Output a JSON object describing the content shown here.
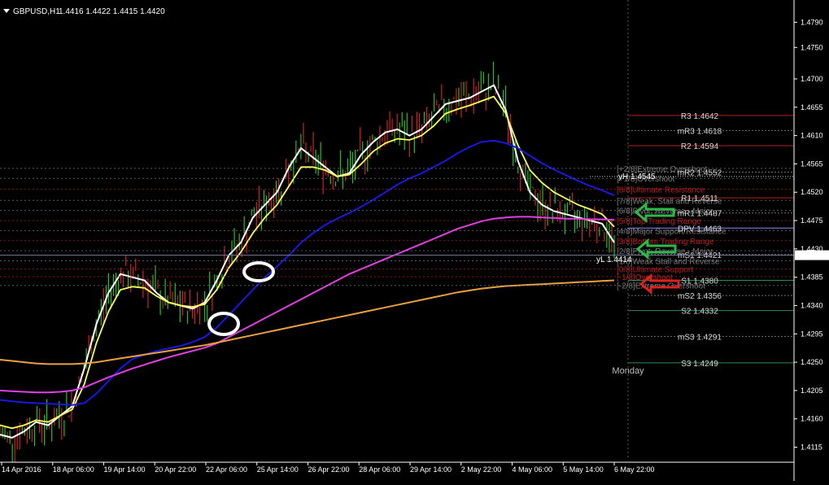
{
  "header": {
    "symbol": "GBPUSD,H1",
    "ohlc": "1.4416 1.4422 1.4415 1.4420",
    "arrow_icon": "triangle-down-icon"
  },
  "chart_data": {
    "type": "line",
    "title": "GBPUSD,H1",
    "ylim": [
      1.4095,
      1.4815
    ],
    "price_ticks": [
      "1.4790",
      "1.4750",
      "1.4700",
      "1.4655",
      "1.4610",
      "1.4565",
      "1.4520",
      "1.4475",
      "1.4430",
      "1.4385",
      "1.4340",
      "1.4295",
      "1.4250",
      "1.4205",
      "1.4160",
      "1.4115"
    ],
    "time_ticks": [
      "14 Apr 2016",
      "18 Apr 06:00",
      "19 Apr 14:00",
      "20 Apr 22:00",
      "22 Apr 06:00",
      "25 Apr 14:00",
      "26 Apr 22:00",
      "28 Apr 06:00",
      "29 Apr 14:00",
      "2 May 22:00",
      "4 May 06:00",
      "5 May 14:00",
      "6 May 22:00"
    ],
    "current_price": "1.4420",
    "session_label": "Monday",
    "pivots": [
      {
        "label": "R3 1.4642",
        "value": 1.4642,
        "color": "#b22222"
      },
      {
        "label": "mR3 1.4618",
        "value": 1.4618,
        "color": "#6e6e6e"
      },
      {
        "label": "R2 1.4594",
        "value": 1.4594,
        "color": "#b22222"
      },
      {
        "label": "mR2 1.4552",
        "value": 1.4552,
        "color": "#6e6e6e"
      },
      {
        "label": "R1 1.4511",
        "value": 1.4511,
        "color": "#b22222"
      },
      {
        "label": "mR1 1.4487",
        "value": 1.4487,
        "color": "#6e6e6e"
      },
      {
        "label": "DPV 1.4463",
        "value": 1.4463,
        "color": "#8a8aff"
      },
      {
        "label": "mS1 1.4421",
        "value": 1.4421,
        "color": "#6e6e6e"
      },
      {
        "label": "S1 1.4380",
        "value": 1.438,
        "color": "#2e8b57"
      },
      {
        "label": "mS2 1.4356",
        "value": 1.4356,
        "color": "#6e6e6e"
      },
      {
        "label": "S2 1.4332",
        "value": 1.4332,
        "color": "#2e8b57"
      },
      {
        "label": "mS3 1.4291",
        "value": 1.4291,
        "color": "#6e6e6e"
      },
      {
        "label": "S3 1.4249",
        "value": 1.4249,
        "color": "#2e8b57"
      }
    ],
    "murrey_levels": [
      {
        "label": "[+2/8]Extreme Overshoot",
        "value": 1.4558,
        "color": "#7a7a7a"
      },
      {
        "label": "[+1/8]Overshoot",
        "value": 1.4542,
        "color": "#7a7a7a"
      },
      {
        "label": "[8/8]Ultimate Resistance",
        "value": 1.4525,
        "color": "#b22222"
      },
      {
        "label": "[7/8]Weak, Stall and Reverse",
        "value": 1.4507,
        "color": "#7a7a7a"
      },
      {
        "label": "[6/8]Pivot, Reverse - Major",
        "value": 1.4491,
        "color": "#7a7a7a"
      },
      {
        "label": "[5/8]Top Trading Range",
        "value": 1.4475,
        "color": "#b22222"
      },
      {
        "label": "[4/8]Major Support/Resistance",
        "value": 1.4459,
        "color": "#7a7a7a"
      },
      {
        "label": "[3/8]Bottom Trading Range",
        "value": 1.4443,
        "color": "#b22222"
      },
      {
        "label": "[2/8]Pivot, Reverse - Major",
        "value": 1.4427,
        "color": "#7a7a7a"
      },
      {
        "label": "[1/8]Weak Stall and Reverse",
        "value": 1.4411,
        "color": "#7a7a7a"
      },
      {
        "label": "[0/8]Ultimate Support",
        "value": 1.4398,
        "color": "#b22222"
      },
      {
        "label": "[-1/8]Overshoot",
        "value": 1.4386,
        "color": "#b22222"
      },
      {
        "label": "[-2/8]Extreme Overshoot",
        "value": 1.4372,
        "color": "#7a7a7a"
      }
    ],
    "high_label": "yH 1.4545",
    "low_label": "yL 1.4414",
    "yh": 1.4545,
    "yl": 1.4414,
    "series": [
      {
        "color": "#ffffff",
        "values": [
          1.4135,
          1.413,
          1.414,
          1.4155,
          1.415,
          1.4165,
          1.418,
          1.424,
          1.431,
          1.436,
          1.439,
          1.4385,
          1.438,
          1.436,
          1.4345,
          1.434,
          1.4335,
          1.4345,
          1.438,
          1.442,
          1.444,
          1.448,
          1.45,
          1.452,
          1.456,
          1.459,
          1.4575,
          1.456,
          1.4545,
          1.455,
          1.458,
          1.46,
          1.4615,
          1.462,
          1.461,
          1.462,
          1.464,
          1.466,
          1.4665,
          1.467,
          1.468,
          1.469,
          1.465,
          1.457,
          1.452,
          1.45,
          1.449,
          1.4485,
          1.448,
          1.4475,
          1.447,
          1.444
        ]
      },
      {
        "color": "#ffff5a",
        "values": [
          1.415,
          1.4145,
          1.415,
          1.4158,
          1.4155,
          1.4165,
          1.4175,
          1.4215,
          1.428,
          1.433,
          1.4365,
          1.437,
          1.4368,
          1.4355,
          1.4345,
          1.434,
          1.4338,
          1.4342,
          1.4365,
          1.44,
          1.4425,
          1.4455,
          1.448,
          1.45,
          1.453,
          1.456,
          1.456,
          1.4555,
          1.4545,
          1.4548,
          1.4565,
          1.4585,
          1.4598,
          1.4605,
          1.4603,
          1.461,
          1.4625,
          1.4645,
          1.4652,
          1.4658,
          1.4665,
          1.4672,
          1.4645,
          1.4595,
          1.4555,
          1.4535,
          1.452,
          1.451,
          1.45,
          1.4493,
          1.4485,
          1.4465
        ]
      },
      {
        "color": "#1818e0",
        "values": [
          1.419,
          1.4188,
          1.4186,
          1.4185,
          1.4184,
          1.4183,
          1.4182,
          1.4185,
          1.42,
          1.422,
          1.424,
          1.4255,
          1.4262,
          1.4268,
          1.4272,
          1.4276,
          1.4282,
          1.429,
          1.4305,
          1.4325,
          1.4345,
          1.4365,
          1.4385,
          1.4402,
          1.442,
          1.444,
          1.4455,
          1.4468,
          1.4478,
          1.4487,
          1.4497,
          1.4508,
          1.452,
          1.4532,
          1.4542,
          1.455,
          1.456,
          1.457,
          1.4582,
          1.4592,
          1.46,
          1.4602,
          1.4598,
          1.459,
          1.4578,
          1.4566,
          1.4556,
          1.4547,
          1.4538,
          1.453,
          1.4523,
          1.4515
        ]
      },
      {
        "color": "#e040e0",
        "values": [
          1.4205,
          1.4204,
          1.4203,
          1.4202,
          1.4202,
          1.4203,
          1.4205,
          1.421,
          1.4218,
          1.4226,
          1.4233,
          1.424,
          1.4246,
          1.4252,
          1.4258,
          1.4263,
          1.4268,
          1.4273,
          1.428,
          1.429,
          1.43,
          1.431,
          1.432,
          1.433,
          1.434,
          1.435,
          1.436,
          1.437,
          1.438,
          1.439,
          1.4398,
          1.4406,
          1.4414,
          1.4422,
          1.443,
          1.4438,
          1.4446,
          1.4454,
          1.4462,
          1.4468,
          1.4474,
          1.4478,
          1.448,
          1.4481,
          1.4481,
          1.448,
          1.4479,
          1.4478,
          1.4478,
          1.4477,
          1.4477,
          1.4476
        ]
      },
      {
        "color": "#e8a040",
        "values": [
          1.4254,
          1.4252,
          1.425,
          1.4248,
          1.4247,
          1.4247,
          1.4247,
          1.4248,
          1.425,
          1.4253,
          1.4256,
          1.4259,
          1.4262,
          1.4265,
          1.4268,
          1.4271,
          1.4274,
          1.4277,
          1.4281,
          1.4285,
          1.4289,
          1.4293,
          1.4297,
          1.4301,
          1.4305,
          1.4309,
          1.4313,
          1.4317,
          1.4321,
          1.4325,
          1.4329,
          1.4333,
          1.4337,
          1.4341,
          1.4345,
          1.4349,
          1.4353,
          1.4357,
          1.4361,
          1.4364,
          1.4367,
          1.4369,
          1.4371,
          1.4372,
          1.4373,
          1.4374,
          1.4375,
          1.4376,
          1.4377,
          1.4378,
          1.4379,
          1.438
        ]
      }
    ]
  }
}
